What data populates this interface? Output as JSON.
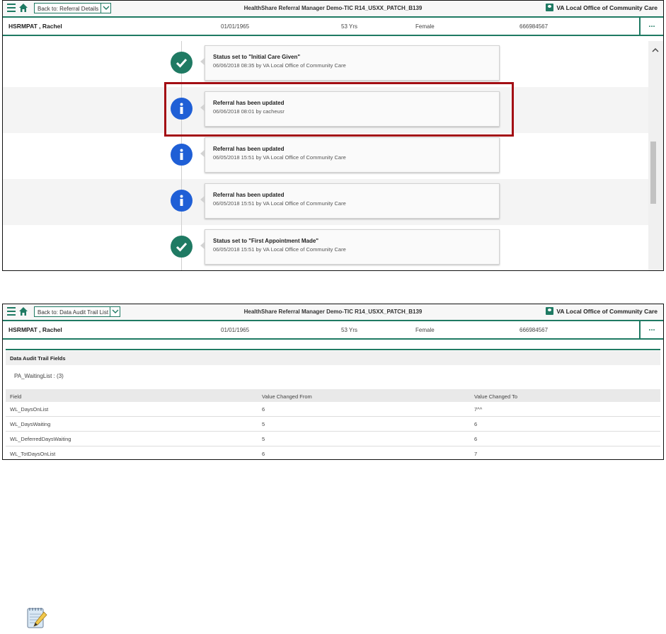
{
  "app_title": "HealthShare Referral Manager Demo-TIC R14_USXX_PATCH_B139",
  "office": "VA Local Office of Community Care",
  "patient": {
    "name": "HSRMPAT , Rachel",
    "dob": "01/01/1965",
    "age": "53 Yrs",
    "sex": "Female",
    "id": "666984567",
    "more": "..."
  },
  "screen1": {
    "back_label": "Back to: Referral Details",
    "events": [
      {
        "icon": "check-icon",
        "title": "Status set to \"Initial Care Given\"",
        "detail": "06/06/2018 08:35 by VA Local Office of Community Care"
      },
      {
        "icon": "info-icon",
        "title": "Referral has been updated",
        "detail": "06/06/2018 08:01 by cacheusr"
      },
      {
        "icon": "info-icon",
        "title": "Referral has been updated",
        "detail": "06/05/2018 15:51 by VA Local Office of Community Care"
      },
      {
        "icon": "info-icon",
        "title": "Referral has been updated",
        "detail": "06/05/2018 15:51 by VA Local Office of Community Care"
      },
      {
        "icon": "check-icon",
        "title": "Status set to \"First Appointment Made\"",
        "detail": "06/05/2018 15:51 by VA Local Office of Community Care"
      }
    ]
  },
  "screen2": {
    "back_label": "Back to: Data Audit Trail List",
    "section_title": "Data Audit Trail Fields",
    "list_name": "PA_WaitingList : (3)",
    "columns": [
      "Field",
      "Value Changed From",
      "Value Changed To"
    ],
    "rows": [
      [
        "WL_DaysOnList",
        "6",
        "7^^"
      ],
      [
        "WL_DaysWaiting",
        "5",
        "6"
      ],
      [
        "WL_DeferredDaysWaiting",
        "5",
        "6"
      ],
      [
        "WL_TotDaysOnList",
        "6",
        "7"
      ]
    ]
  },
  "colors": {
    "accent": "#1f7a63",
    "info": "#1f5fd6",
    "highlight": "#a30e14"
  }
}
